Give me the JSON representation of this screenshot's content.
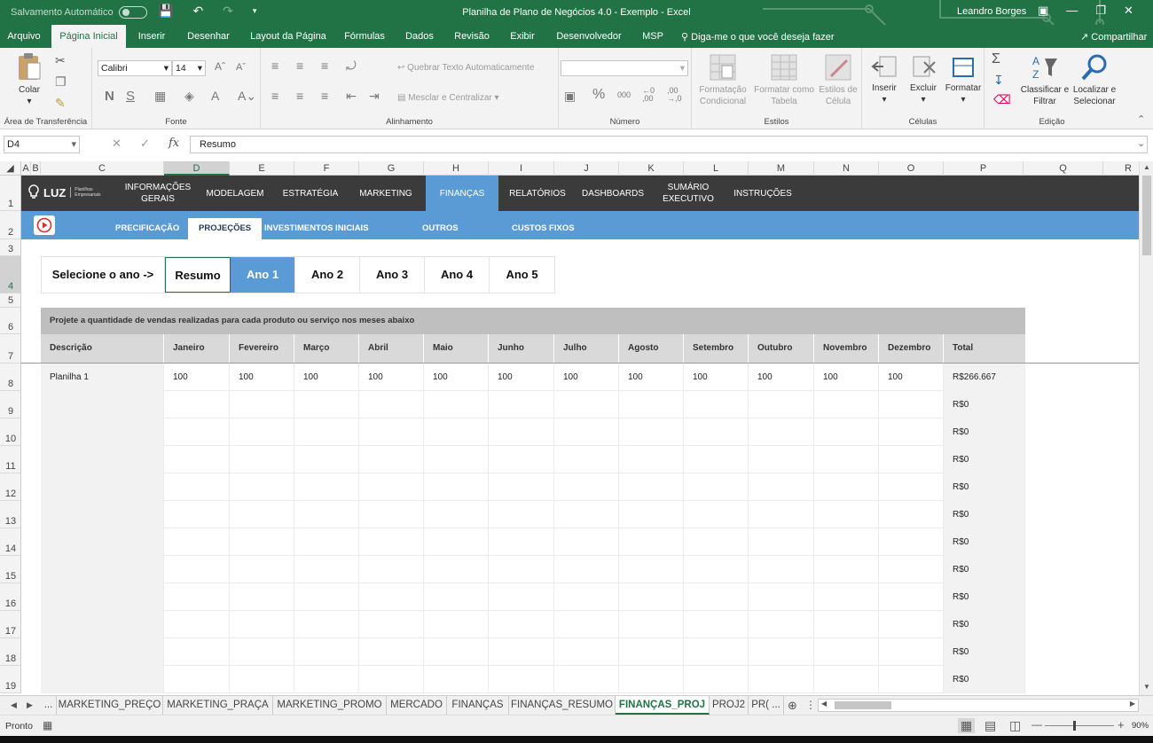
{
  "titlebar": {
    "autosave_label": "Salvamento Automático",
    "doc_title": "Planilha de Plano de Negócios 4.0 - Exemplo  -  Excel",
    "user": "Leandro Borges"
  },
  "ribbon_tabs": [
    {
      "label": "Arquivo"
    },
    {
      "label": "Página Inicial"
    },
    {
      "label": "Inserir"
    },
    {
      "label": "Desenhar"
    },
    {
      "label": "Layout da Página"
    },
    {
      "label": "Fórmulas"
    },
    {
      "label": "Dados"
    },
    {
      "label": "Revisão"
    },
    {
      "label": "Exibir"
    },
    {
      "label": "Desenvolvedor"
    },
    {
      "label": "MSP"
    }
  ],
  "tellme": "Diga-me o que você deseja fazer",
  "share": "Compartilhar",
  "ribbon": {
    "clipboard": {
      "paste": "Colar",
      "group": "Área de Transferência"
    },
    "font": {
      "name": "Calibri",
      "size": "14",
      "group": "Fonte",
      "bold": "N",
      "italic": "S"
    },
    "alignment": {
      "wrap": "Quebrar Texto Automaticamente",
      "merge": "Mesclar e Centralizar",
      "group": "Alinhamento"
    },
    "number": {
      "group": "Número",
      "percent": "%",
      "thousands": "000"
    },
    "styles": {
      "conditional": "Formatação Condicional",
      "as_table": "Formatar como Tabela",
      "cell_styles": "Estilos de Célula",
      "group": "Estilos"
    },
    "cells": {
      "insert": "Inserir",
      "delete": "Excluir",
      "format": "Formatar",
      "group": "Células"
    },
    "editing": {
      "sort": "Classificar e Filtrar",
      "find": "Localizar e Selecionar",
      "group": "Edição",
      "sigma": "Σ"
    }
  },
  "formula_bar": {
    "name_box": "D4",
    "fx": "fx",
    "formula": "Resumo"
  },
  "columns": [
    "A",
    "B",
    "C",
    "D",
    "E",
    "F",
    "G",
    "H",
    "I",
    "J",
    "K",
    "L",
    "M",
    "N",
    "O",
    "P",
    "Q",
    "R"
  ],
  "rows": [
    "1",
    "2",
    "3",
    "4",
    "5",
    "6",
    "7",
    "8",
    "9",
    "10",
    "11",
    "12",
    "13",
    "14",
    "15",
    "16",
    "17",
    "18",
    "19"
  ],
  "topnav": {
    "logo": "LUZ",
    "logo_sub": "Planilhas Empresariais",
    "items": [
      {
        "label": "INFORMAÇÕES GERAIS"
      },
      {
        "label": "MODELAGEM"
      },
      {
        "label": "ESTRATÉGIA"
      },
      {
        "label": "MARKETING"
      },
      {
        "label": "FINANÇAS"
      },
      {
        "label": "RELATÓRIOS"
      },
      {
        "label": "DASHBOARDS"
      },
      {
        "label": "SUMÁRIO EXECUTIVO"
      },
      {
        "label": "INSTRUÇÕES"
      }
    ]
  },
  "subnav": {
    "items": [
      {
        "label": "PRECIFICAÇÃO"
      },
      {
        "label": "PROJEÇÕES"
      },
      {
        "label": "INVESTIMENTOS INICIAIS"
      },
      {
        "label": "OUTROS"
      },
      {
        "label": "CUSTOS FIXOS"
      }
    ]
  },
  "year_selector": {
    "label": "Selecione o ano ->",
    "options": [
      "Resumo",
      "Ano 1",
      "Ano 2",
      "Ano 3",
      "Ano 4",
      "Ano 5"
    ],
    "active": "Ano 1"
  },
  "banner": "Projete a quantidade de vendas realizadas para cada produto ou serviço nos meses abaixo",
  "table": {
    "headers": [
      "Descrição",
      "Janeiro",
      "Fevereiro",
      "Março",
      "Abril",
      "Maio",
      "Junho",
      "Julho",
      "Agosto",
      "Setembro",
      "Outubro",
      "Novembro",
      "Dezembro",
      "Total"
    ],
    "rows": [
      [
        "Planilha 1",
        "100",
        "100",
        "100",
        "100",
        "100",
        "100",
        "100",
        "100",
        "100",
        "100",
        "100",
        "100",
        "R$266.667"
      ],
      [
        "",
        "",
        "",
        "",
        "",
        "",
        "",
        "",
        "",
        "",
        "",
        "",
        "",
        "R$0"
      ],
      [
        "",
        "",
        "",
        "",
        "",
        "",
        "",
        "",
        "",
        "",
        "",
        "",
        "",
        "R$0"
      ],
      [
        "",
        "",
        "",
        "",
        "",
        "",
        "",
        "",
        "",
        "",
        "",
        "",
        "",
        "R$0"
      ],
      [
        "",
        "",
        "",
        "",
        "",
        "",
        "",
        "",
        "",
        "",
        "",
        "",
        "",
        "R$0"
      ],
      [
        "",
        "",
        "",
        "",
        "",
        "",
        "",
        "",
        "",
        "",
        "",
        "",
        "",
        "R$0"
      ],
      [
        "",
        "",
        "",
        "",
        "",
        "",
        "",
        "",
        "",
        "",
        "",
        "",
        "",
        "R$0"
      ],
      [
        "",
        "",
        "",
        "",
        "",
        "",
        "",
        "",
        "",
        "",
        "",
        "",
        "",
        "R$0"
      ],
      [
        "",
        "",
        "",
        "",
        "",
        "",
        "",
        "",
        "",
        "",
        "",
        "",
        "",
        "R$0"
      ],
      [
        "",
        "",
        "",
        "",
        "",
        "",
        "",
        "",
        "",
        "",
        "",
        "",
        "",
        "R$0"
      ],
      [
        "",
        "",
        "",
        "",
        "",
        "",
        "",
        "",
        "",
        "",
        "",
        "",
        "",
        "R$0"
      ],
      [
        "",
        "",
        "",
        "",
        "",
        "",
        "",
        "",
        "",
        "",
        "",
        "",
        "",
        "R$0"
      ]
    ]
  },
  "sheet_tabs": [
    {
      "label": "..."
    },
    {
      "label": "MARKETING_PREÇO"
    },
    {
      "label": "MARKETING_PRAÇA"
    },
    {
      "label": "MARKETING_PROMO"
    },
    {
      "label": "MERCADO"
    },
    {
      "label": "FINANÇAS"
    },
    {
      "label": "FINANÇAS_RESUMO"
    },
    {
      "label": "FINANÇAS_PROJ"
    },
    {
      "label": "PROJ2"
    },
    {
      "label": "PR( ..."
    }
  ],
  "statusbar": {
    "ready": "Pronto",
    "zoom": "90%"
  },
  "colors": {
    "excel_green": "#217346",
    "nav_dark": "#3b3b3b",
    "accent_blue": "#5b9bd5"
  }
}
